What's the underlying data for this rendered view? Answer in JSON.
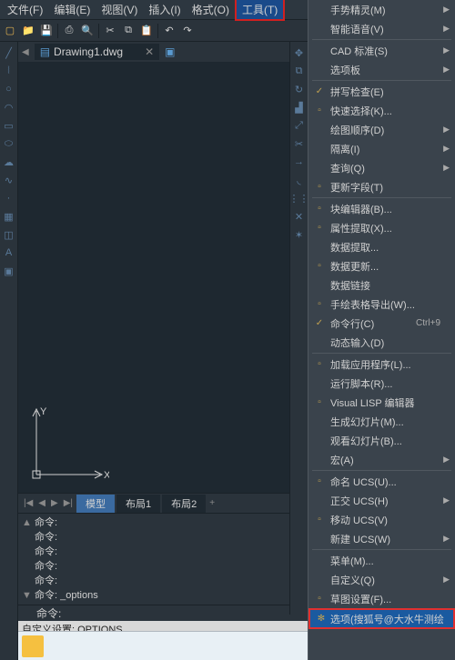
{
  "menubar": [
    {
      "label": "文件(F)"
    },
    {
      "label": "编辑(E)"
    },
    {
      "label": "视图(V)"
    },
    {
      "label": "插入(I)"
    },
    {
      "label": "格式(O)"
    },
    {
      "label": "工具(T)",
      "active": true
    }
  ],
  "document": {
    "name": "Drawing1.dwg",
    "close": "✕"
  },
  "canvas": {
    "y_label": "Y",
    "x_label": "X"
  },
  "layout": {
    "tabs": [
      {
        "label": "模型",
        "active": true
      },
      {
        "label": "布局1"
      },
      {
        "label": "布局2"
      }
    ],
    "add": "+"
  },
  "command": {
    "history": [
      "命令:",
      "命令:",
      "命令:",
      "命令:",
      "命令:",
      "命令: _options"
    ],
    "prompt": "命令:",
    "status": "自定义设置: OPTIONS"
  },
  "dropdown": {
    "items": [
      {
        "label": "手势精灵(M)",
        "arrow": true
      },
      {
        "label": "智能语音(V)",
        "arrow": true
      },
      {
        "sep": true
      },
      {
        "label": "CAD 标准(S)",
        "arrow": true
      },
      {
        "label": "选项板",
        "arrow": true
      },
      {
        "sep": true
      },
      {
        "label": "拼写检查(E)",
        "icon": "✓"
      },
      {
        "label": "快速选择(K)...",
        "icon": "▫"
      },
      {
        "label": "绘图顺序(D)",
        "arrow": true
      },
      {
        "label": "隔离(I)",
        "arrow": true
      },
      {
        "label": "查询(Q)",
        "arrow": true
      },
      {
        "label": "更新字段(T)",
        "icon": "▫"
      },
      {
        "sep": true
      },
      {
        "label": "块编辑器(B)...",
        "icon": "▫"
      },
      {
        "label": "属性提取(X)...",
        "icon": "▫"
      },
      {
        "label": "数据提取..."
      },
      {
        "label": "数据更新...",
        "icon": "▫"
      },
      {
        "label": "数据链接"
      },
      {
        "label": "手绘表格导出(W)...",
        "icon": "▫"
      },
      {
        "label": "命令行(C)",
        "icon": "✓",
        "shortcut": "Ctrl+9"
      },
      {
        "label": "动态输入(D)"
      },
      {
        "sep": true
      },
      {
        "label": "加载应用程序(L)...",
        "icon": "▫"
      },
      {
        "label": "运行脚本(R)..."
      },
      {
        "label": "Visual LISP 编辑器",
        "icon": "▫"
      },
      {
        "label": "生成幻灯片(M)..."
      },
      {
        "label": "观看幻灯片(B)..."
      },
      {
        "label": "宏(A)",
        "arrow": true
      },
      {
        "sep": true
      },
      {
        "label": "命名 UCS(U)...",
        "icon": "▫"
      },
      {
        "label": "正交 UCS(H)",
        "arrow": true
      },
      {
        "label": "移动 UCS(V)",
        "icon": "▫"
      },
      {
        "label": "新建 UCS(W)",
        "arrow": true
      },
      {
        "sep": true
      },
      {
        "label": "菜单(M)..."
      },
      {
        "label": "自定义(Q)",
        "arrow": true
      },
      {
        "label": "草图设置(F)...",
        "icon": "▫"
      },
      {
        "label": "选项(搜狐号@大水牛测绘",
        "icon": "✻",
        "highlight": true
      }
    ]
  }
}
